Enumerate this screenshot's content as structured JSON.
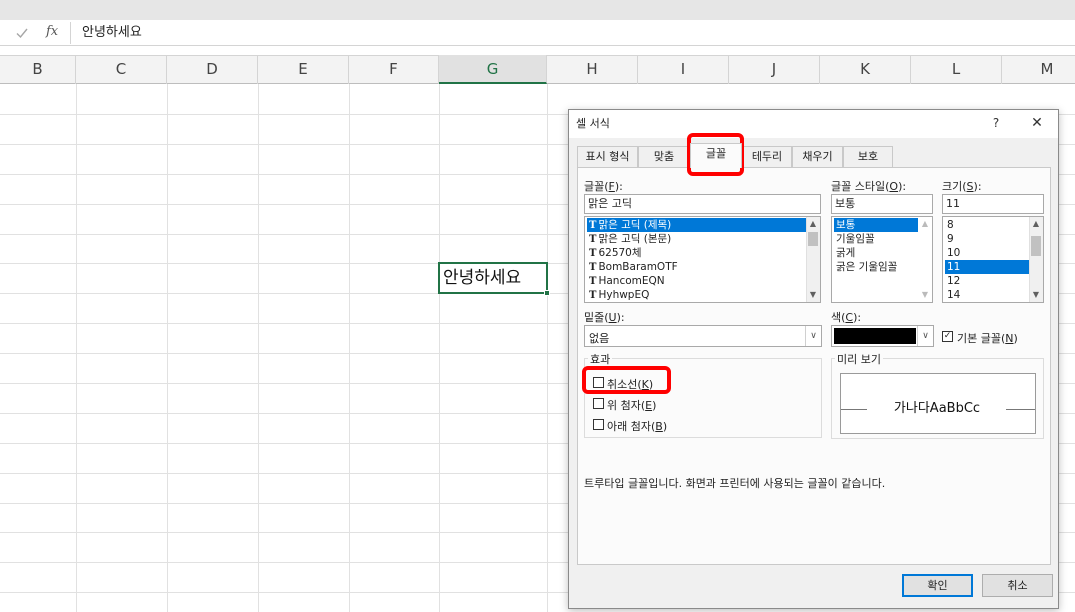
{
  "formula_bar": {
    "cancel_icon": "check-icon",
    "fx_label": "fx",
    "value": "안녕하세요"
  },
  "columns": [
    "B",
    "C",
    "D",
    "E",
    "F",
    "G",
    "H",
    "I",
    "J",
    "K",
    "L",
    "M"
  ],
  "active_column": "G",
  "active_cell_value": "안녕하세요",
  "dialog": {
    "title": "셀 서식",
    "help": "?",
    "close": "✕",
    "tabs": [
      "표시 형식",
      "맞춤",
      "글꼴",
      "테두리",
      "채우기",
      "보호"
    ],
    "selected_tab": "글꼴",
    "font": {
      "label": "글꼴(",
      "label_key": "F",
      "label_end": "):",
      "value": "맑은 고딕",
      "list": [
        "맑은 고딕 (제목)",
        "맑은 고딕 (본문)",
        "62570체",
        "BomBaramOTF",
        "HancomEQN",
        "HyhwpEQ"
      ],
      "selected_index": 0
    },
    "style": {
      "label": "글꼴 스타일(",
      "label_key": "O",
      "label_end": "):",
      "value": "보통",
      "list": [
        "보통",
        "기울임꼴",
        "굵게",
        "굵은 기울임꼴"
      ],
      "selected_index": 0
    },
    "size": {
      "label": "크기(",
      "label_key": "S",
      "label_end": "):",
      "value": "11",
      "list": [
        "8",
        "9",
        "10",
        "11",
        "12",
        "14"
      ],
      "selected_index": 3
    },
    "underline": {
      "label": "밑줄(",
      "label_key": "U",
      "label_end": "):",
      "value": "없음"
    },
    "color": {
      "label": "색(",
      "label_key": "C",
      "label_end": "):",
      "swatch": "#000000",
      "default_font_label": "기본 글꼴(",
      "default_font_key": "N",
      "default_font_end": ")",
      "default_font_checked": true
    },
    "effects": {
      "label": "효과",
      "strikethrough": {
        "label": "취소선(",
        "key": "K",
        "end": ")",
        "checked": false
      },
      "superscript": {
        "label": "위 첨자(",
        "key": "E",
        "end": ")",
        "checked": false
      },
      "subscript": {
        "label": "아래 첨자(",
        "key": "B",
        "end": ")",
        "checked": false
      }
    },
    "preview": {
      "label": "미리 보기",
      "sample": "가나다AaBbCc"
    },
    "info_text": "트루타입 글꼴입니다. 화면과 프린터에 사용되는 글꼴이 같습니다.",
    "ok": "확인",
    "cancel": "취소"
  },
  "accent_colors": {
    "excel_green": "#217346",
    "selection_blue": "#0078d7",
    "annotation_red": "#ff0000"
  }
}
